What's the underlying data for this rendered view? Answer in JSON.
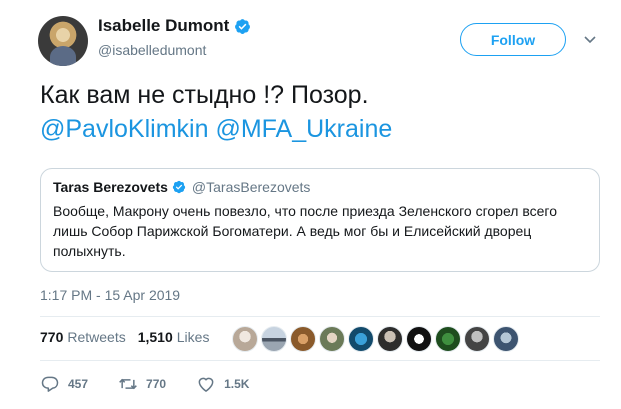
{
  "author": {
    "display_name": "Isabelle Dumont",
    "handle": "@isabelledumont"
  },
  "follow_label": "Follow",
  "tweet": {
    "text_line1": "Как вам не стыдно !?  Позор.",
    "mention1": "@PavloKlimkin",
    "mention2": "@MFA_Ukraine"
  },
  "quoted": {
    "name": "Taras Berezovets",
    "handle": "@TarasBerezovets",
    "text": "Вообще, Макрону очень повезло, что после приезда Зеленского сгорел всего лишь Собор Парижской Богоматери. А ведь мог бы и Елисейский дворец полыхнуть."
  },
  "timestamp": "1:17 PM - 15 Apr 2019",
  "stats": {
    "retweets_count": "770",
    "retweets_label": "Retweets",
    "likes_count": "1,510",
    "likes_label": "Likes"
  },
  "actions": {
    "reply_count": "457",
    "retweet_count": "770",
    "like_count": "1.5K"
  },
  "colors": {
    "accent": "#1da1f2",
    "mention": "#1b95e0",
    "secondary_text": "#657786"
  },
  "icons": [
    "verified-badge-icon",
    "chevron-down-icon",
    "reply-icon",
    "retweet-icon",
    "heart-icon"
  ]
}
